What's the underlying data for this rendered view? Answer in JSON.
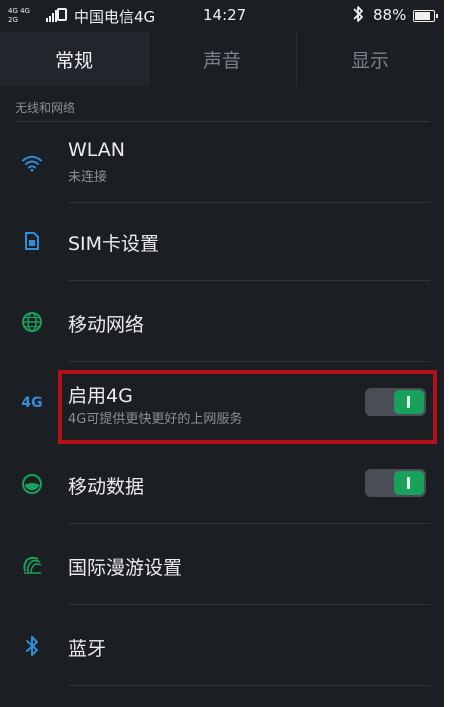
{
  "status_bar": {
    "network_top": "4G 4G",
    "network_bottom": "2G",
    "carrier": "中国电信4G",
    "time": "14:27",
    "battery": "88%",
    "battery_level": 0.88
  },
  "tabs": [
    {
      "label": "常规",
      "active": true
    },
    {
      "label": "声音",
      "active": false
    },
    {
      "label": "显示",
      "active": false
    }
  ],
  "section": {
    "title": "无线和网络"
  },
  "rows": {
    "wlan": {
      "title": "WLAN",
      "subtitle": "未连接",
      "icon": "wifi-icon"
    },
    "sim": {
      "title": "SIM卡设置",
      "icon": "sim-card-icon"
    },
    "mobile_network": {
      "title": "移动网络",
      "icon": "globe-icon"
    },
    "enable_4g": {
      "title": "启用4G",
      "subtitle": "4G可提供更快更好的上网服务",
      "icon_label": "4G",
      "toggle_on": true
    },
    "mobile_data": {
      "title": "移动数据",
      "icon": "mobile-data-icon",
      "toggle_on": true
    },
    "roaming": {
      "title": "国际漫游设置",
      "icon": "roaming-globe-icon"
    },
    "bluetooth": {
      "title": "蓝牙",
      "icon": "bluetooth-icon"
    }
  },
  "colors": {
    "background": "#1b1e23",
    "accent_blue": "#2f8fd8",
    "accent_green": "#19a15c",
    "highlight_red": "#b3121b"
  }
}
